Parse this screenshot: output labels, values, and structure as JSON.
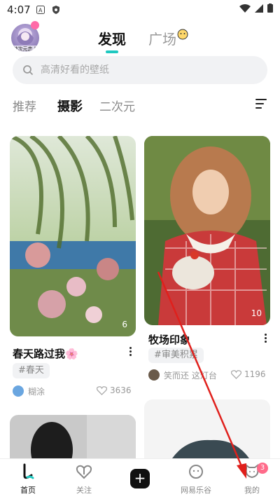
{
  "status_bar": {
    "time": "4:07"
  },
  "header": {
    "avatar_caption": "破次元恋人",
    "tabs": [
      {
        "label": "发现"
      },
      {
        "label": "广场"
      }
    ]
  },
  "search": {
    "placeholder": "高清好看的壁纸"
  },
  "categories": [
    {
      "label": "推荐"
    },
    {
      "label": "摄影"
    },
    {
      "label": "二次元"
    }
  ],
  "feed": {
    "cards": [
      {
        "title": "春天路过我🌸",
        "tag": "#春天",
        "author": "糊涂",
        "likes": "3636",
        "image_count": "6"
      },
      {
        "title": "牧场印象",
        "tag": "#审美积累",
        "author": "笑而还 这灯台",
        "likes": "1196",
        "image_count": "10"
      }
    ]
  },
  "bottom_nav": {
    "items": [
      {
        "label": "首页"
      },
      {
        "label": "关注"
      },
      {
        "label": "网易乐谷"
      },
      {
        "label": "我的"
      }
    ],
    "badge_count": "3"
  },
  "colors": {
    "accent": "#1ec8c0",
    "badge": "#ff6b8a",
    "annotation": "#e0201c"
  }
}
